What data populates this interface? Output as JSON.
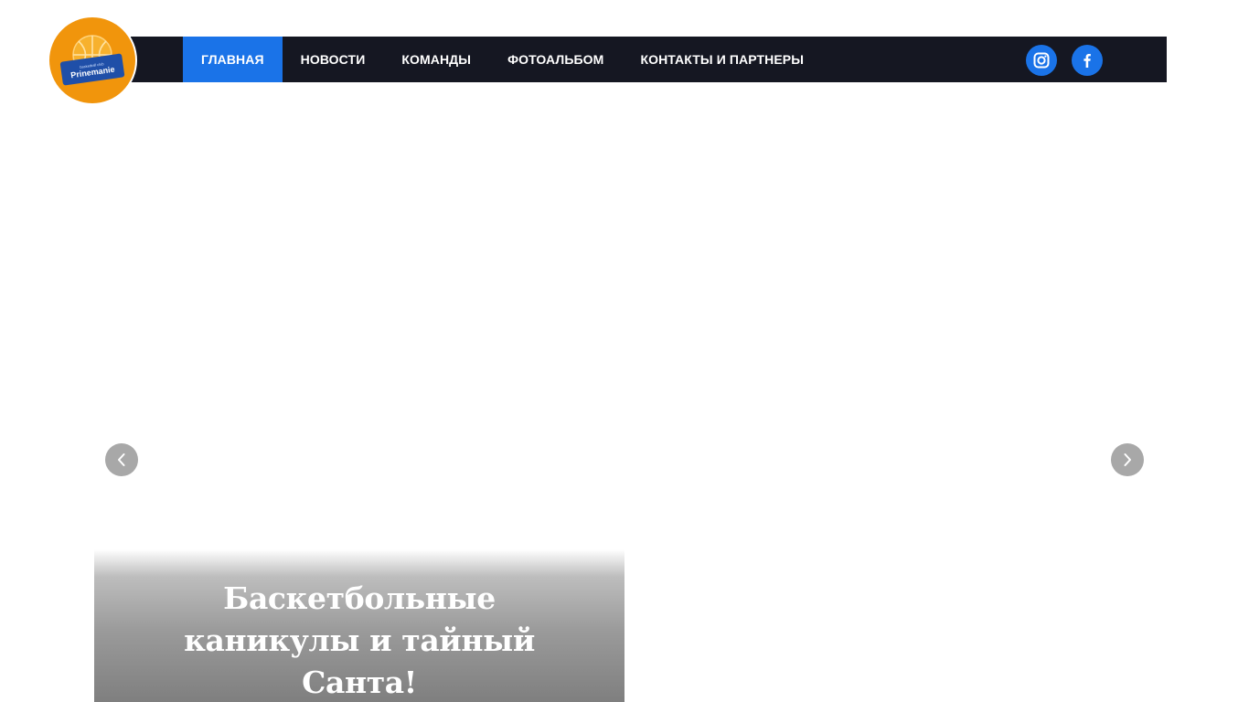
{
  "logo": {
    "small_text": "basketball club",
    "name": "Prinemanie"
  },
  "nav": {
    "items": [
      {
        "label": "ГЛАВНАЯ",
        "active": true
      },
      {
        "label": "НОВОСТИ",
        "active": false
      },
      {
        "label": "КОМАНДЫ",
        "active": false
      },
      {
        "label": "ФОТОАЛЬБОМ",
        "active": false
      },
      {
        "label": "КОНТАКТЫ И ПАРТНЕРЫ",
        "active": false
      }
    ]
  },
  "social": {
    "icons": [
      "instagram-icon",
      "facebook-icon"
    ]
  },
  "slider": {
    "prev_icon": "chevron-left-icon",
    "next_icon": "chevron-right-icon"
  },
  "post": {
    "title": "Баскетбольные каникулы и тайный Санта!"
  },
  "colors": {
    "nav_bg": "#151722",
    "accent": "#1a73e8",
    "logo_orange": "#f1950c",
    "arrow_bg": "#a8a8a8"
  }
}
